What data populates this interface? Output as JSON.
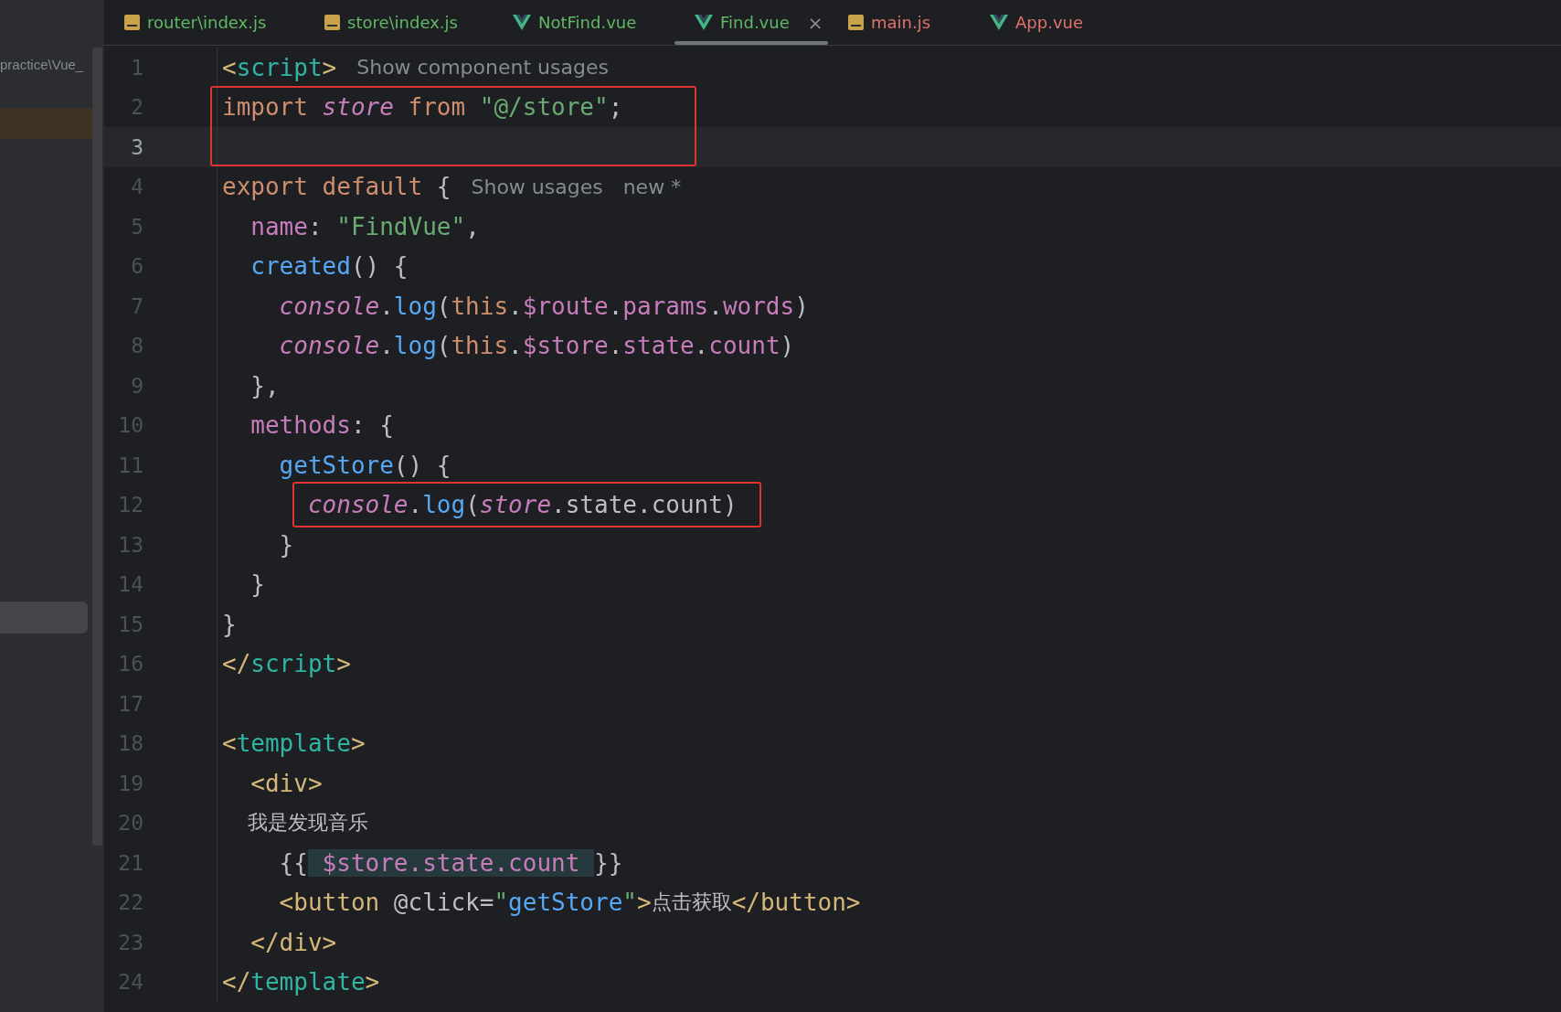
{
  "sidebar": {
    "path_text": "practice\\Vue_"
  },
  "tabs": [
    {
      "label": "router\\index.js",
      "kind": "js",
      "color": "#5fb865",
      "selected": false
    },
    {
      "label": "store\\index.js",
      "kind": "js",
      "color": "#5fb865",
      "selected": false
    },
    {
      "label": "NotFind.vue",
      "kind": "vue",
      "color": "#5fb865",
      "selected": false
    },
    {
      "label": "Find.vue",
      "kind": "vue",
      "color": "#5fb865",
      "selected": true,
      "close": "×"
    },
    {
      "label": "main.js",
      "kind": "js",
      "color": "#e0736c",
      "selected": false
    },
    {
      "label": "App.vue",
      "kind": "vue",
      "color": "#e0736c",
      "selected": false
    }
  ],
  "editor": {
    "lines": [
      {
        "number": "1",
        "current": false,
        "tokens": [
          {
            "kind": "tag",
            "text": "<"
          },
          {
            "kind": "vue_tag",
            "text": "script"
          },
          {
            "kind": "tag",
            "text": ">"
          },
          {
            "kind": "hint",
            "text": "Show component usages"
          }
        ]
      },
      {
        "number": "2",
        "current": false,
        "kind": "boxtall",
        "tokens": [
          {
            "kind": "keyword",
            "text": "import "
          },
          {
            "kind": "variable",
            "text": "store"
          },
          {
            "kind": "keyword",
            "text": " from "
          },
          {
            "kind": "string",
            "text": "\"@/store\""
          },
          {
            "kind": "plain",
            "text": ";"
          }
        ]
      },
      {
        "number": "3",
        "current": true
      },
      {
        "number": "4",
        "current": false,
        "tokens": [
          {
            "kind": "keyword",
            "text": "export default "
          },
          {
            "kind": "plain",
            "text": "{"
          },
          {
            "kind": "hint",
            "text": "Show usages"
          },
          {
            "kind": "hint",
            "text": "new *"
          }
        ]
      },
      {
        "number": "5",
        "current": false,
        "tokens": [
          {
            "kind": "property",
            "text": "  name"
          },
          {
            "kind": "plain",
            "text": ": "
          },
          {
            "kind": "string",
            "text": "\"FindVue\""
          },
          {
            "kind": "plain",
            "text": ","
          }
        ]
      },
      {
        "number": "6",
        "current": false,
        "tokens": [
          {
            "kind": "function",
            "text": "  created"
          },
          {
            "kind": "plain",
            "text": "() {"
          }
        ]
      },
      {
        "number": "7",
        "current": false,
        "tokens": [
          {
            "kind": "variable",
            "text": "    console"
          },
          {
            "kind": "plain",
            "text": "."
          },
          {
            "kind": "function",
            "text": "log"
          },
          {
            "kind": "plain",
            "text": "("
          },
          {
            "kind": "keyword",
            "text": "this"
          },
          {
            "kind": "plain",
            "text": "."
          },
          {
            "kind": "property",
            "text": "$route"
          },
          {
            "kind": "plain",
            "text": "."
          },
          {
            "kind": "property",
            "text": "params"
          },
          {
            "kind": "plain",
            "text": "."
          },
          {
            "kind": "property",
            "text": "words"
          },
          {
            "kind": "plain",
            "text": ")"
          }
        ]
      },
      {
        "number": "8",
        "current": false,
        "tokens": [
          {
            "kind": "variable",
            "text": "    console"
          },
          {
            "kind": "plain",
            "text": "."
          },
          {
            "kind": "function",
            "text": "log"
          },
          {
            "kind": "plain",
            "text": "("
          },
          {
            "kind": "keyword",
            "text": "this"
          },
          {
            "kind": "plain",
            "text": "."
          },
          {
            "kind": "property",
            "text": "$store"
          },
          {
            "kind": "plain",
            "text": "."
          },
          {
            "kind": "property",
            "text": "state"
          },
          {
            "kind": "plain",
            "text": "."
          },
          {
            "kind": "property",
            "text": "count"
          },
          {
            "kind": "plain",
            "text": ")"
          }
        ]
      },
      {
        "number": "9",
        "current": false,
        "tokens": [
          {
            "kind": "plain",
            "text": "  },"
          }
        ]
      },
      {
        "number": "10",
        "current": false,
        "tokens": [
          {
            "kind": "property",
            "text": "  methods"
          },
          {
            "kind": "plain",
            "text": ": {"
          }
        ]
      },
      {
        "number": "11",
        "current": false,
        "tokens": [
          {
            "kind": "function",
            "text": "    getStore"
          },
          {
            "kind": "plain",
            "text": "() {"
          }
        ]
      },
      {
        "number": "12",
        "current": false,
        "kind": "boxed",
        "tokens": [
          {
            "kind": "variable",
            "text": "      console"
          },
          {
            "kind": "plain",
            "text": "."
          },
          {
            "kind": "function",
            "text": "log"
          },
          {
            "kind": "plain",
            "text": "("
          },
          {
            "kind": "variable",
            "text": "store"
          },
          {
            "kind": "plain",
            "text": ".state.count)"
          }
        ]
      },
      {
        "number": "13",
        "current": false,
        "tokens": [
          {
            "kind": "plain",
            "text": "    }"
          }
        ]
      },
      {
        "number": "14",
        "current": false,
        "tokens": [
          {
            "kind": "plain",
            "text": "  }"
          }
        ]
      },
      {
        "number": "15",
        "current": false,
        "tokens": [
          {
            "kind": "plain",
            "text": "}"
          }
        ]
      },
      {
        "number": "16",
        "current": false,
        "tokens": [
          {
            "kind": "tag",
            "text": "</"
          },
          {
            "kind": "vue_tag",
            "text": "script"
          },
          {
            "kind": "tag",
            "text": ">"
          }
        ]
      },
      {
        "number": "17",
        "current": false
      },
      {
        "number": "18",
        "current": false,
        "tokens": [
          {
            "kind": "tag",
            "text": "<"
          },
          {
            "kind": "vue_tag",
            "text": "template"
          },
          {
            "kind": "tag",
            "text": ">"
          }
        ]
      },
      {
        "number": "19",
        "current": false,
        "tokens": [
          {
            "kind": "tag",
            "text": "  <div>"
          }
        ]
      },
      {
        "number": "20",
        "current": false,
        "tokens": [
          {
            "kind": "cjk",
            "text": "    我是发现音乐"
          }
        ]
      },
      {
        "number": "21",
        "current": false,
        "tokens": [
          {
            "kind": "plain",
            "text": "    {{"
          },
          {
            "kind": "injected",
            "text": " $store.state.count "
          },
          {
            "kind": "plain",
            "text": "}}"
          }
        ]
      },
      {
        "number": "22",
        "current": false,
        "tokens": [
          {
            "kind": "tag",
            "text": "    <button "
          },
          {
            "kind": "plain",
            "text": "@click="
          },
          {
            "kind": "string",
            "text": "\""
          },
          {
            "kind": "function",
            "text": "getStore"
          },
          {
            "kind": "string",
            "text": "\""
          },
          {
            "kind": "tag",
            "text": ">"
          },
          {
            "kind": "cjk",
            "text": "点击获取"
          },
          {
            "kind": "tag",
            "text": "</button>"
          }
        ]
      },
      {
        "number": "23",
        "current": false,
        "tokens": [
          {
            "kind": "tag",
            "text": "  </div>"
          }
        ]
      },
      {
        "number": "24",
        "current": false,
        "tokens": [
          {
            "kind": "tag",
            "text": "</"
          },
          {
            "kind": "vue_tag",
            "text": "template"
          },
          {
            "kind": "tag",
            "text": ">"
          }
        ]
      }
    ]
  }
}
